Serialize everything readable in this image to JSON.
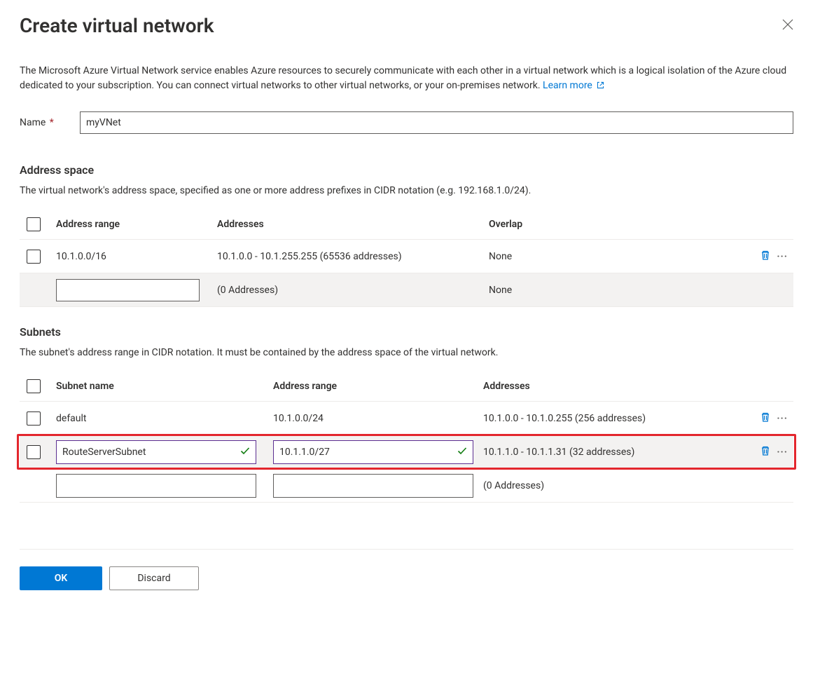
{
  "header": {
    "title": "Create virtual network"
  },
  "intro": {
    "text": "The Microsoft Azure Virtual Network service enables Azure resources to securely communicate with each other in a virtual network which is a logical isolation of the Azure cloud dedicated to your subscription. You can connect virtual networks to other virtual networks, or your on-premises network. ",
    "link_label": "Learn more"
  },
  "name_field": {
    "label": "Name",
    "value": "myVNet"
  },
  "address_space": {
    "title": "Address space",
    "description": "The virtual network's address space, specified as one or more address prefixes in CIDR notation (e.g. 192.168.1.0/24).",
    "columns": {
      "c1": "Address range",
      "c2": "Addresses",
      "c3": "Overlap"
    },
    "rows": [
      {
        "range": "10.1.0.0/16",
        "addresses": "10.1.0.0 - 10.1.255.255 (65536 addresses)",
        "overlap": "None"
      }
    ],
    "empty_row": {
      "range": "",
      "addresses": "(0 Addresses)",
      "overlap": "None"
    }
  },
  "subnets": {
    "title": "Subnets",
    "description": "The subnet's address range in CIDR notation. It must be contained by the address space of the virtual network.",
    "columns": {
      "c1": "Subnet name",
      "c2": "Address range",
      "c3": "Addresses"
    },
    "rows": [
      {
        "name": "default",
        "range": "10.1.0.0/24",
        "addresses": "10.1.0.0 - 10.1.0.255 (256 addresses)"
      },
      {
        "name": "RouteServerSubnet",
        "range": "10.1.1.0/27",
        "addresses": "10.1.1.0 - 10.1.1.31 (32 addresses)"
      }
    ],
    "empty_row": {
      "name": "",
      "range": "",
      "addresses": "(0 Addresses)"
    }
  },
  "footer": {
    "ok_label": "OK",
    "discard_label": "Discard"
  }
}
